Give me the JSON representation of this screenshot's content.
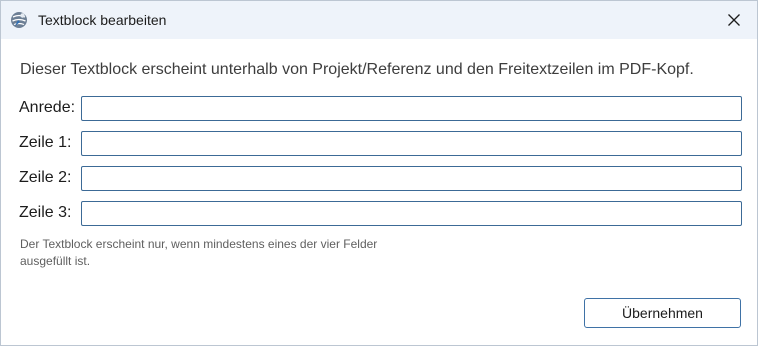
{
  "window": {
    "title": "Textblock bearbeiten",
    "app_icon": "globe-icon",
    "close_icon": "close-icon"
  },
  "dialog": {
    "intro": "Dieser Textblock erscheint unterhalb von Projekt/Referenz und den Freitextzeilen im PDF-Kopf.",
    "fields": [
      {
        "label": "Anrede:",
        "value": ""
      },
      {
        "label": "Zeile 1:",
        "value": ""
      },
      {
        "label": "Zeile 2:",
        "value": ""
      },
      {
        "label": "Zeile 3:",
        "value": ""
      }
    ],
    "hint": "Der Textblock erscheint nur, wenn mindestens eines der vier Felder ausgefüllt ist.",
    "submit_label": "Übernehmen"
  },
  "colors": {
    "titlebar_bg": "#eef3fa",
    "input_border": "#3c6a96",
    "button_border": "#3f72a6",
    "hint_text": "#5f5f5f"
  }
}
